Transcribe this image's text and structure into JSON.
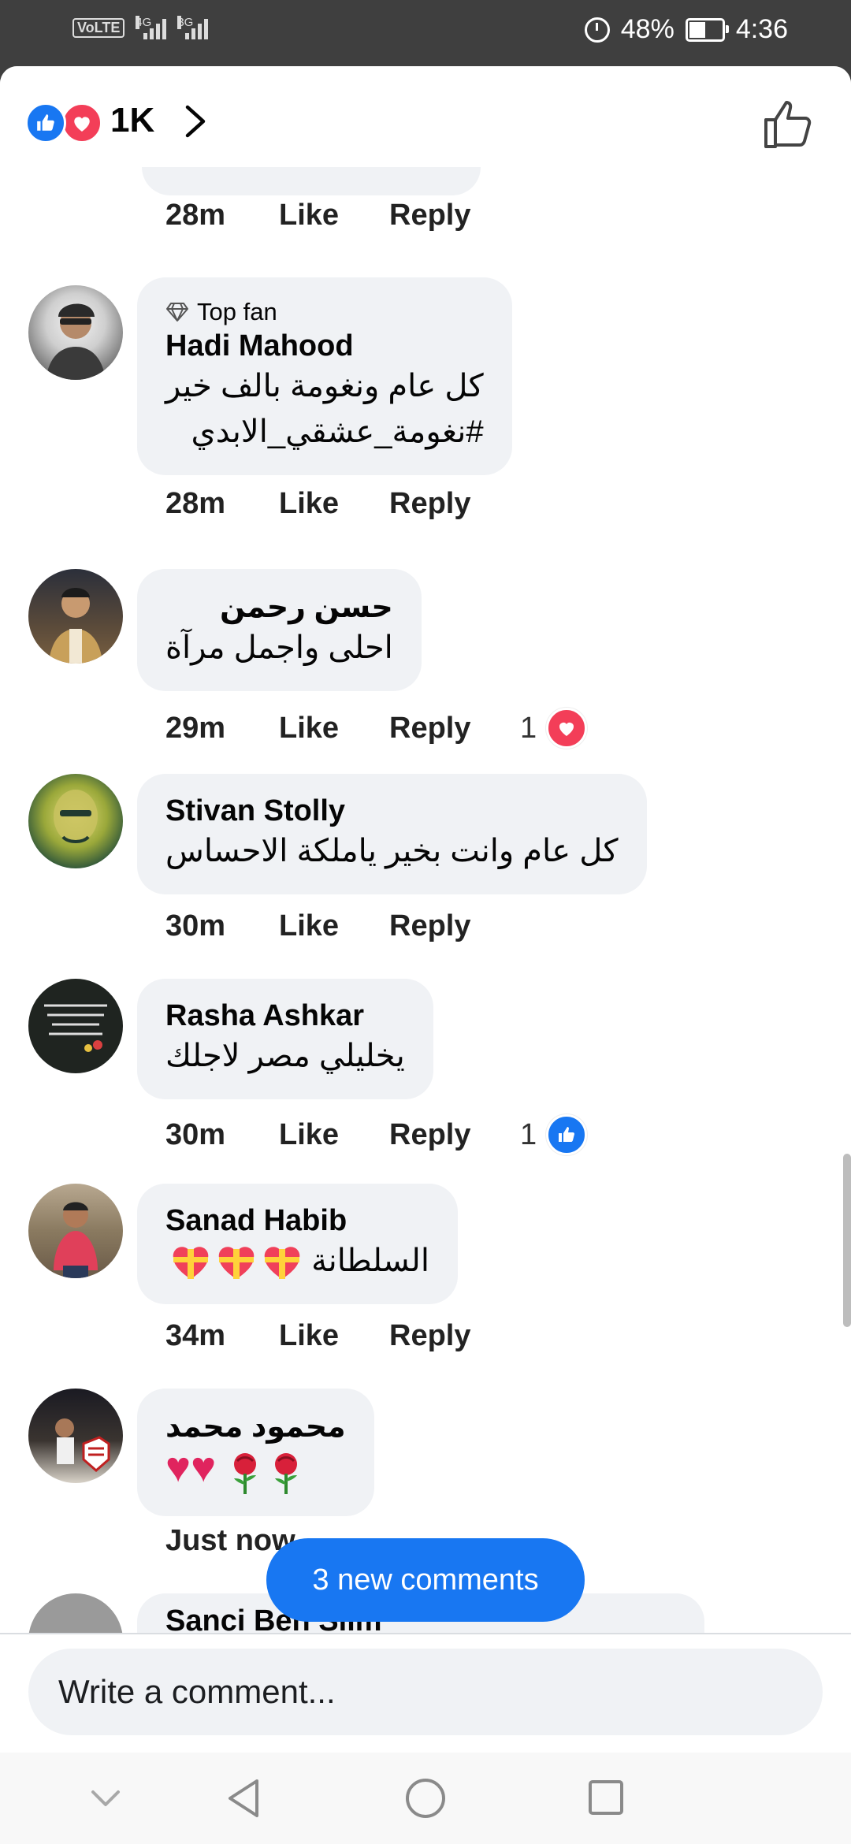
{
  "status_bar": {
    "volte": "VoLTE",
    "net1": "4G",
    "net2": "3G",
    "battery_percent": "48%",
    "battery_level": 0.48,
    "time": "4:36"
  },
  "header": {
    "reaction_count": "1K"
  },
  "previous_comment": {
    "time": "28m",
    "like": "Like",
    "reply": "Reply"
  },
  "comments": [
    {
      "badge": "Top fan",
      "author": "Hadi Mahood",
      "lines": [
        "كل عام ونغومة بالف خير",
        "#نغومة_عشقي_الابدي"
      ],
      "time": "28m",
      "like": "Like",
      "reply": "Reply"
    },
    {
      "author": "حسن رحمن",
      "lines": [
        "احلى واجمل مرآة"
      ],
      "time": "29m",
      "like": "Like",
      "reply": "Reply",
      "reaction_count": "1",
      "reaction": "love"
    },
    {
      "author": "Stivan Stolly",
      "lines": [
        "كل عام وانت بخير ياملكة الاحساس"
      ],
      "time": "30m",
      "like": "Like",
      "reply": "Reply"
    },
    {
      "author": "Rasha Ashkar",
      "lines": [
        "يخليلي مصر لاجلك"
      ],
      "time": "30m",
      "like": "Like",
      "reply": "Reply",
      "reaction_count": "1",
      "reaction": "like"
    },
    {
      "author": "Sanad Habib",
      "lines": [
        "السلطانة"
      ],
      "time": "34m",
      "like": "Like",
      "reply": "Reply"
    },
    {
      "author": "محمود محمد",
      "lines": [
        ""
      ],
      "time": "Just now"
    },
    {
      "author": "Sanci Ben Slim"
    }
  ],
  "new_comments_pill": "3 new comments",
  "composer": {
    "placeholder": "Write a comment..."
  },
  "nav_bar": {
    "icons": [
      "chevron-down-icon",
      "back-icon",
      "home-icon",
      "recents-icon"
    ]
  },
  "colors": {
    "accent": "#1877f2",
    "love": "#f33e58",
    "bubble": "#f0f2f5"
  }
}
